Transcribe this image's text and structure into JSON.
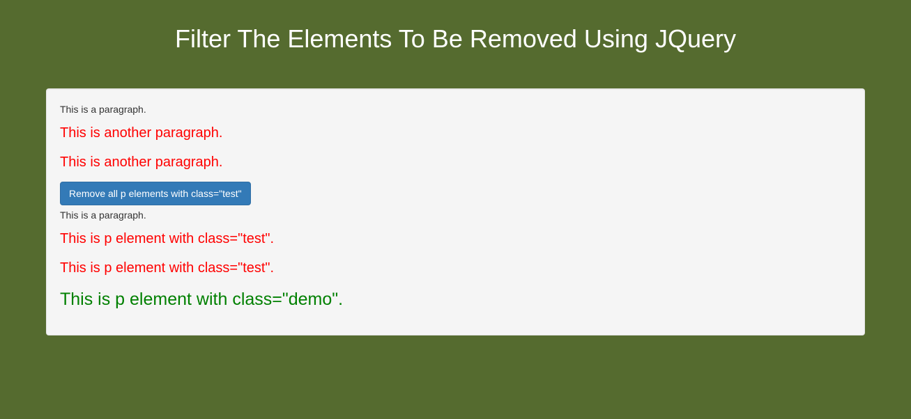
{
  "header": {
    "title": "Filter The Elements To Be Removed Using JQuery"
  },
  "well": {
    "para1": "This is a paragraph.",
    "test1": "This is another paragraph.",
    "test2": "This is another paragraph.",
    "button_label": "Remove all p elements with class=\"test\"",
    "para2": "This is a paragraph.",
    "test3": "This is p element with class=\"test\".",
    "test4": "This is p element with class=\"test\".",
    "demo1": "This is p element with class=\"demo\"."
  }
}
